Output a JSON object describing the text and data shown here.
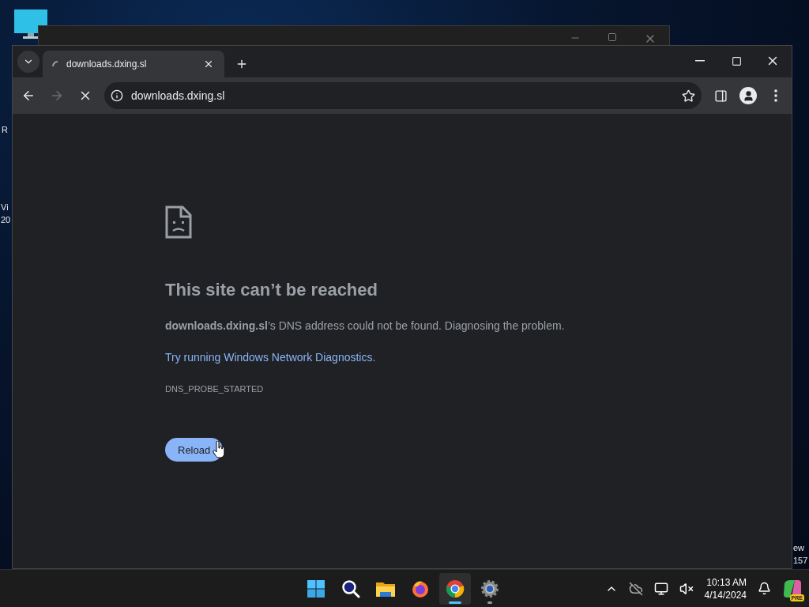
{
  "desktop": {
    "label_fragments": [
      {
        "lines": [
          "R"
        ]
      },
      {
        "lines": [
          "Vi",
          "20"
        ]
      },
      {
        "lines": [
          "ew",
          "157"
        ]
      }
    ]
  },
  "browser": {
    "tabs": [
      {
        "title": "downloads.dxing.sl",
        "selected": true,
        "loading": true
      }
    ],
    "address": "downloads.dxing.sl",
    "page": {
      "heading": "This site can’t be reached",
      "message": "**downloads.dxing.sl**’s DNS address could not be found. Diagnosing the problem.",
      "link": "Try running Windows Network Diagnostics.",
      "error_code": "DNS_PROBE_STARTED",
      "button": "Reload"
    }
  },
  "taskbar": {
    "apps": [
      {
        "kind": "start",
        "active": false,
        "running": false
      },
      {
        "kind": "search",
        "active": false,
        "running": false
      },
      {
        "kind": "files",
        "active": false,
        "running": false
      },
      {
        "kind": "firefox",
        "active": false,
        "running": false
      },
      {
        "kind": "chrome",
        "active": true,
        "running": true
      },
      {
        "kind": "settings",
        "active": false,
        "running": true
      }
    ],
    "time": "10:13 AM",
    "date": "4/14/2024",
    "copilot_badge": "PRE"
  }
}
